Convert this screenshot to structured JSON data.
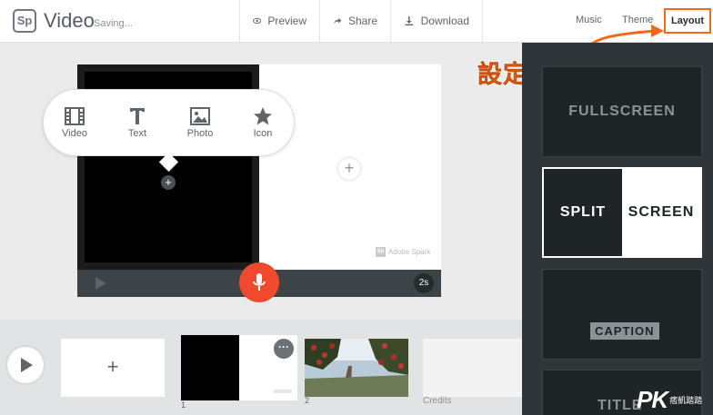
{
  "header": {
    "logo_text": "Sp",
    "app_title": "Video",
    "save_status": "Saving...",
    "actions": {
      "preview": "Preview",
      "share": "Share",
      "download": "Download"
    },
    "tabs": {
      "music": "Music",
      "theme": "Theme",
      "layout": "Layout"
    },
    "highlight_color": "#f2691e"
  },
  "annotation": {
    "text": "設定版型"
  },
  "layouts": {
    "fullscreen": "FULLSCREEN",
    "split_left": "SPLIT",
    "split_right": "SCREEN",
    "caption": "CAPTION",
    "title": "TITLE"
  },
  "insert_menu": {
    "video": "Video",
    "text": "Text",
    "photo": "Photo",
    "icon": "Icon"
  },
  "stage": {
    "watermark_logo": "Sp",
    "watermark": "Adobe Spark",
    "duration": "2s",
    "add_symbol": "+"
  },
  "timeline": {
    "add_symbol": "+",
    "more_symbol": "···",
    "slide_1_number": "1",
    "slide_2_number": "2",
    "credits_label": "Credits"
  },
  "site_watermark": {
    "brand": "PK",
    "name": "痞凱踏踏"
  },
  "colors": {
    "mic": "#f0492e",
    "panel_bg": "#2f3538"
  }
}
